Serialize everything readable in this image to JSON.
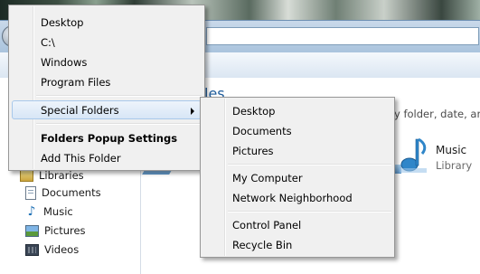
{
  "explorer": {
    "heading": "les",
    "subtitle": "y folder, date, and",
    "sidebar": {
      "libraries": "Libraries",
      "items": [
        "Documents",
        "Music",
        "Pictures",
        "Videos"
      ]
    },
    "tile": {
      "name": "Music",
      "type": "Library"
    }
  },
  "main_menu": {
    "items": [
      "Desktop",
      "C:\\",
      "Windows",
      "Program Files"
    ],
    "special": "Special Folders",
    "settings": "Folders Popup Settings",
    "add": "Add This Folder"
  },
  "sub_menu": {
    "group1": [
      "Desktop",
      "Documents",
      "Pictures"
    ],
    "group2": [
      "My Computer",
      "Network Neighborhood"
    ],
    "group3": [
      "Control Panel",
      "Recycle Bin"
    ]
  },
  "icons": {
    "submenu_arrow": "chevron-right-icon",
    "music": "music-note-icon",
    "documents": "document-icon",
    "pictures": "picture-icon",
    "videos": "video-icon",
    "libraries": "folder-icon"
  },
  "colors": {
    "menu_bg": "#f0f0f0",
    "highlight": "#d7e6f6",
    "highlight_border": "#a8c8ea",
    "heading_blue": "#1e5c9b"
  }
}
